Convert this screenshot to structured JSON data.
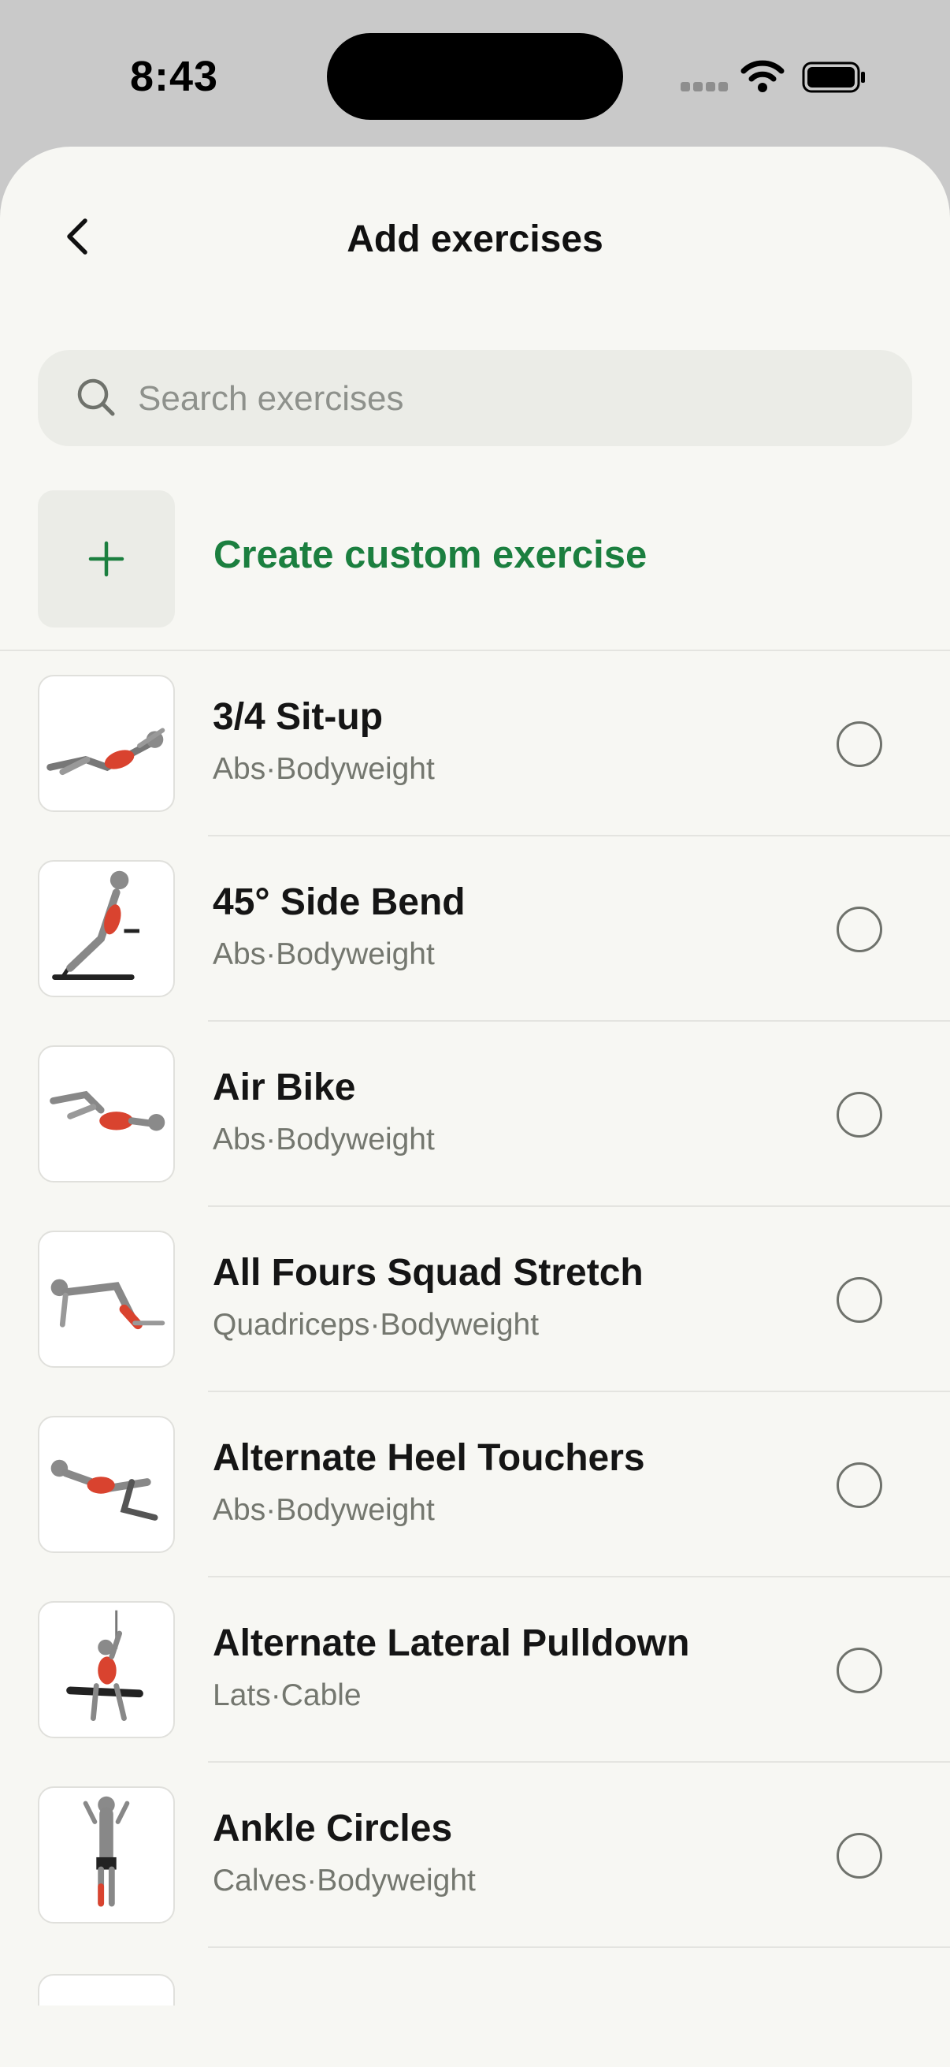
{
  "status_bar": {
    "time": "8:43"
  },
  "header": {
    "title": "Add exercises"
  },
  "search": {
    "placeholder": "Search exercises",
    "value": ""
  },
  "create_custom": {
    "label": "Create custom exercise"
  },
  "colors": {
    "accent": "#1b7f3f",
    "muscle_highlight": "#d9432f",
    "background": "#f7f7f3"
  },
  "exercises": [
    {
      "name": "3/4 Sit-up",
      "muscle": "Abs",
      "separator": "·",
      "equipment": "Bodyweight",
      "selected": false
    },
    {
      "name": "45° Side Bend",
      "muscle": "Abs",
      "separator": "·",
      "equipment": "Bodyweight",
      "selected": false
    },
    {
      "name": "Air Bike",
      "muscle": "Abs",
      "separator": "·",
      "equipment": "Bodyweight",
      "selected": false
    },
    {
      "name": "All Fours Squad Stretch",
      "muscle": "Quadriceps",
      "separator": "·",
      "equipment": "Bodyweight",
      "selected": false
    },
    {
      "name": "Alternate Heel Touchers",
      "muscle": "Abs",
      "separator": "·",
      "equipment": "Bodyweight",
      "selected": false
    },
    {
      "name": "Alternate Lateral Pulldown",
      "muscle": "Lats",
      "separator": "·",
      "equipment": "Cable",
      "selected": false
    },
    {
      "name": "Ankle Circles",
      "muscle": "Calves",
      "separator": "·",
      "equipment": "Bodyweight",
      "selected": false
    }
  ]
}
